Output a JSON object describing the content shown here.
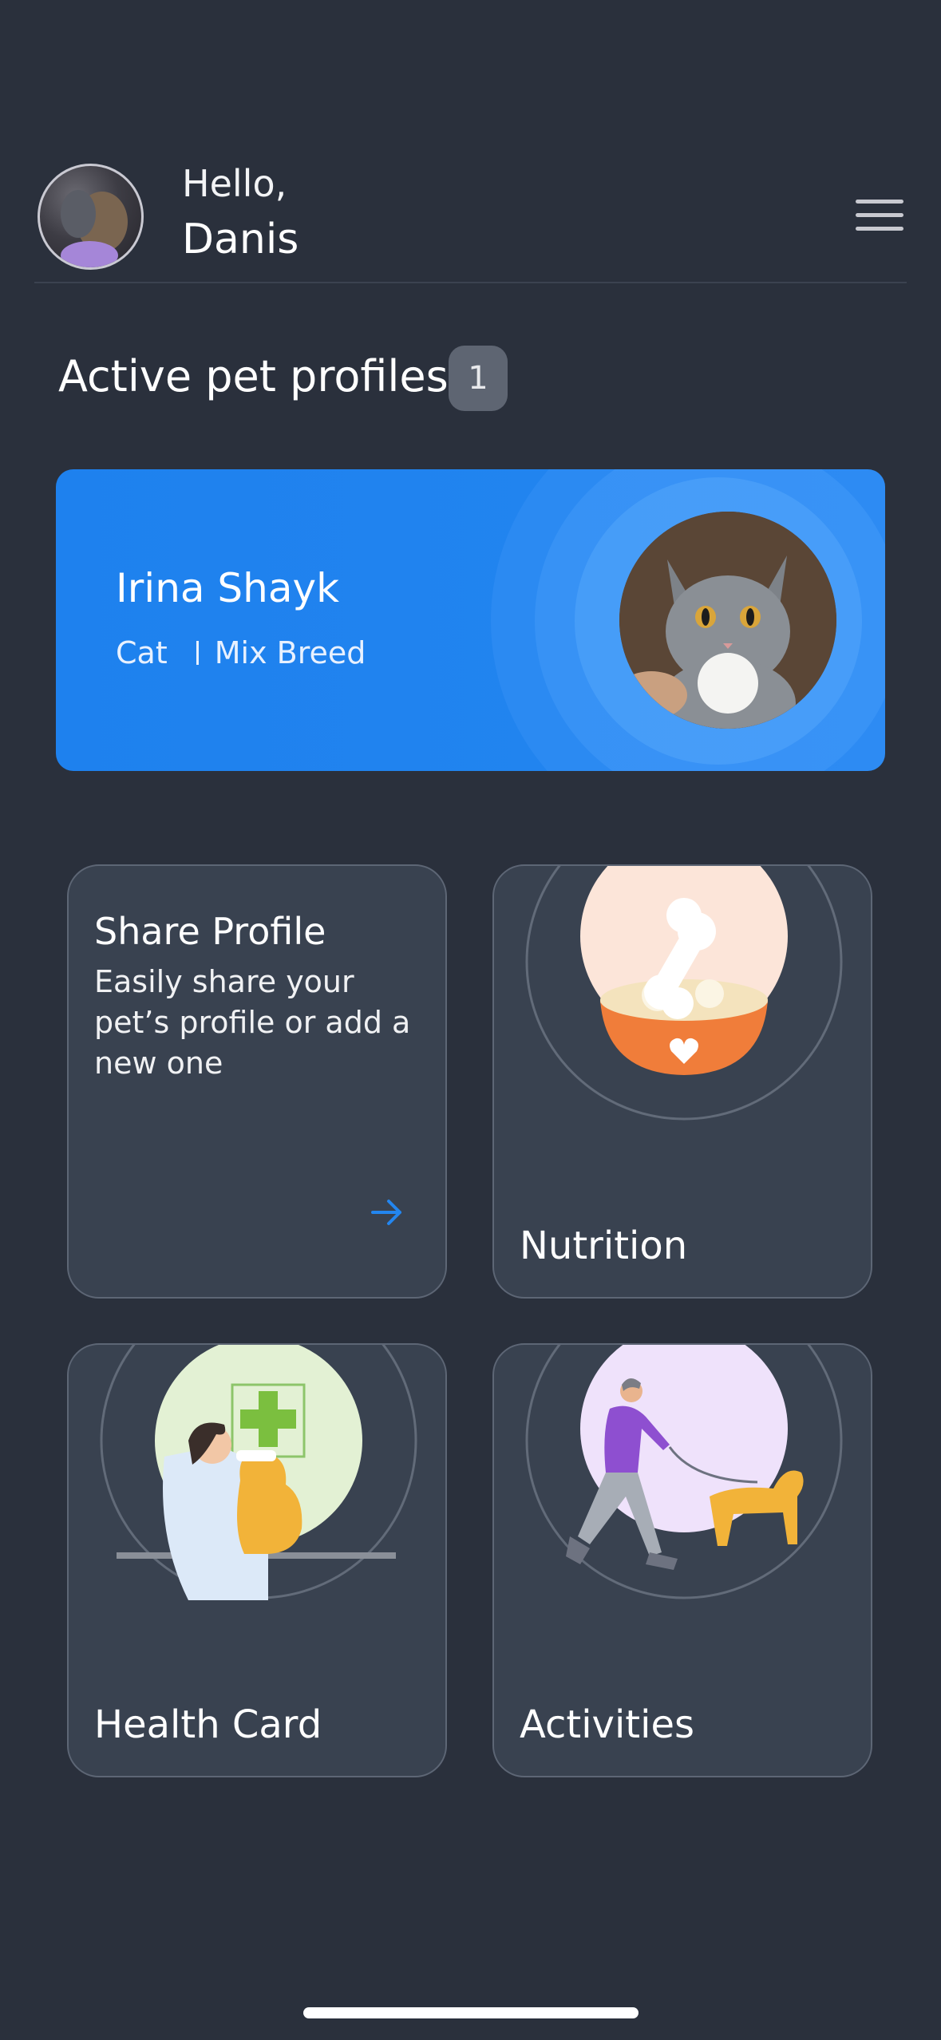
{
  "header": {
    "greeting": "Hello,",
    "user_name": "Danis"
  },
  "profiles": {
    "title": "Active pet profiles",
    "count": "1",
    "pet": {
      "name": "Irina Shayk",
      "species": "Cat",
      "breed": "Mix Breed"
    }
  },
  "tiles": {
    "share": {
      "title": "Share Profile",
      "description": "Easily share your pet’s profile or add a new one"
    },
    "nutrition": {
      "label": "Nutrition"
    },
    "health": {
      "label": "Health Card"
    },
    "activities": {
      "label": "Activities"
    }
  },
  "colors": {
    "background": "#2a303c",
    "card_blue": "#1e81ee",
    "tile": "#394250",
    "accent_arrow": "#2386f0"
  }
}
